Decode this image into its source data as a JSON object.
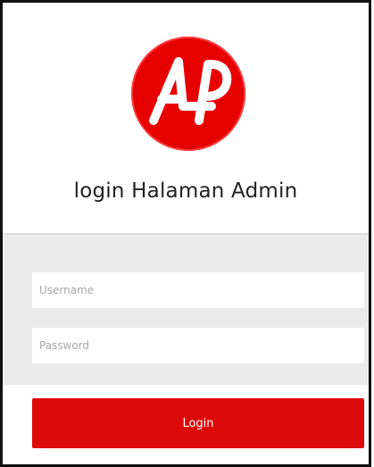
{
  "header": {
    "logo_text": "ALP",
    "title": "login Halaman Admin"
  },
  "form": {
    "username_placeholder": "Username",
    "password_placeholder": "Password",
    "login_label": "Login"
  },
  "colors": {
    "brand_red": "#dd0a0a",
    "logo_red": "#e60000",
    "form_background": "#ebebeb"
  },
  "icons": {
    "logo": "alp-logo"
  }
}
